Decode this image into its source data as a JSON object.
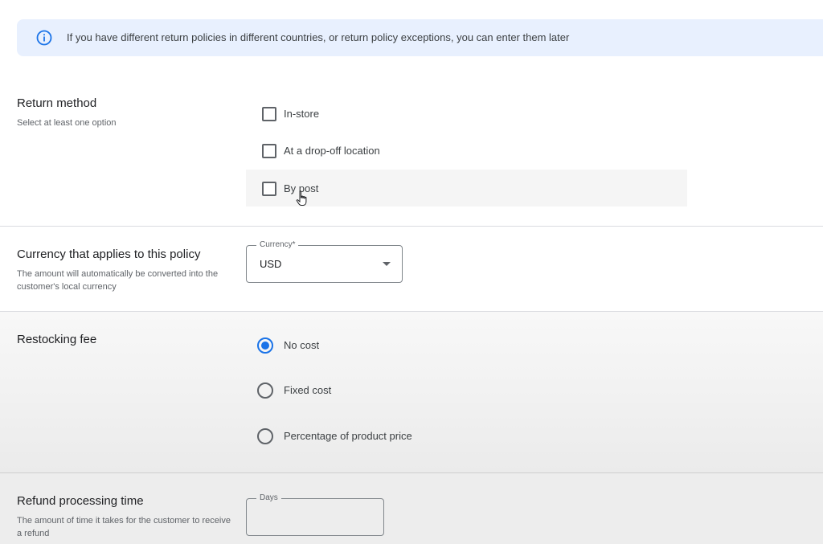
{
  "banner": {
    "text": "If you have different return policies in different countries, or return policy exceptions, you can enter them later",
    "icon": "info-icon"
  },
  "return_method": {
    "title": "Return method",
    "description": "Select at least one option",
    "options": [
      {
        "label": "In-store",
        "checked": false
      },
      {
        "label": "At a drop-off location",
        "checked": false
      },
      {
        "label": "By post",
        "checked": false
      }
    ]
  },
  "currency": {
    "title": "Currency that applies to this policy",
    "description": "The amount will automatically be converted into the customer's local currency",
    "field_label": "Currency*",
    "value": "USD"
  },
  "restocking_fee": {
    "title": "Restocking fee",
    "options": [
      {
        "label": "No cost",
        "selected": true
      },
      {
        "label": "Fixed cost",
        "selected": false
      },
      {
        "label": "Percentage of product price",
        "selected": false
      }
    ]
  },
  "refund_processing": {
    "title": "Refund processing time",
    "description": "The amount of time it takes for the customer to receive a refund",
    "field_label": "Days",
    "value": ""
  },
  "colors": {
    "accent": "#1a73e8",
    "banner_bg": "#e8f0fe"
  }
}
